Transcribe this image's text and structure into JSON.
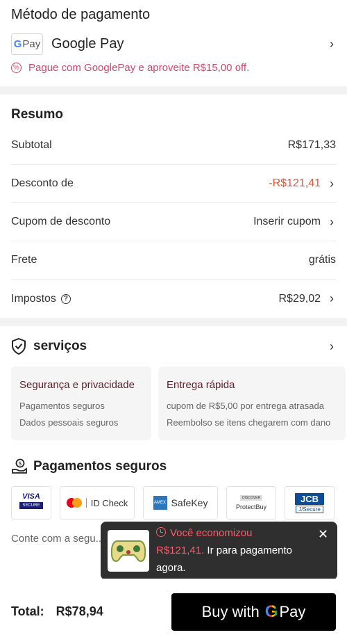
{
  "payment_method": {
    "title": "Método de pagamento",
    "logo_g": "G",
    "logo_pay": "Pay",
    "name": "Google Pay",
    "promo": "Pague com GooglePay e aproveite R$15,00 off."
  },
  "summary": {
    "title": "Resumo",
    "rows": [
      {
        "label": "Subtotal",
        "value": "R$171,33"
      },
      {
        "label": "Desconto de",
        "value": "-R$121,41"
      },
      {
        "label": "Cupom de desconto",
        "value": "Inserir cupom"
      },
      {
        "label": "Frete",
        "value": "grátis"
      },
      {
        "label": "Impostos",
        "value": "R$29,02"
      }
    ]
  },
  "services": {
    "title": "serviços",
    "cards": [
      {
        "title": "Segurança e privacidade",
        "lines": [
          "Pagamentos seguros",
          "Dados pessoais seguros"
        ]
      },
      {
        "title": "Entrega rápida",
        "lines": [
          "cupom de R$5,00 por entrega atrasada",
          "Reembolso se itens chegarem com dano"
        ]
      }
    ]
  },
  "secure_payments": {
    "title": "Pagamentos seguros",
    "logos": {
      "visa": "VISA",
      "visa_sub": "SECURE",
      "mc": "ID Check",
      "amex_box": "AMEX",
      "amex": "SafeKey",
      "discover": "DISCOVER",
      "protectbuy": "ProtectBuy",
      "jcb": "JCB",
      "jcb_sub": "J/Secure"
    },
    "text": "Conte com a segu... parceiros de paga..."
  },
  "tooltip": {
    "headline": "Você economizou",
    "amount": "R$121,41.",
    "rest": " Ir para pagamento agora."
  },
  "bottom": {
    "total_label": "Total:",
    "total_value": "R$78,94",
    "buy_prefix": "Buy with",
    "buy_g": "G",
    "buy_pay": "Pay"
  },
  "colors": {
    "accent_red": "#d9593b",
    "promo_pink": "#d3456a"
  }
}
